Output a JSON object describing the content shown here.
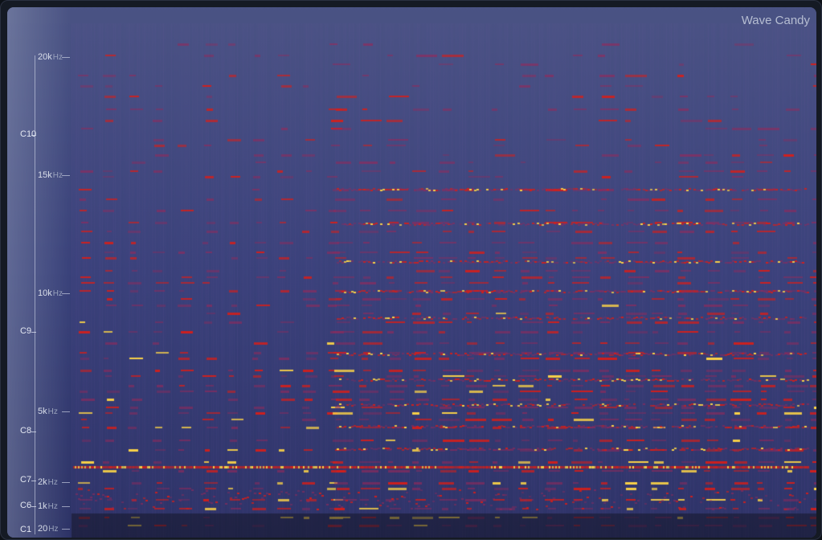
{
  "window": {
    "title": "Wave Candy"
  },
  "frequency_axis": [
    {
      "value": "20k",
      "unit": "Hz"
    },
    {
      "value": "15k",
      "unit": "Hz"
    },
    {
      "value": "10k",
      "unit": "Hz"
    },
    {
      "value": "5k",
      "unit": "Hz"
    },
    {
      "value": "2k",
      "unit": "Hz"
    },
    {
      "value": "1k",
      "unit": "Hz"
    },
    {
      "value": "20",
      "unit": "Hz"
    }
  ],
  "note_axis": [
    "C10",
    "C9",
    "C8",
    "C7",
    "C6",
    "C1"
  ],
  "colors": {
    "background": "#3a4378",
    "low": "#4a3d8a",
    "mid": "#d01818",
    "high": "#ffd23a"
  }
}
